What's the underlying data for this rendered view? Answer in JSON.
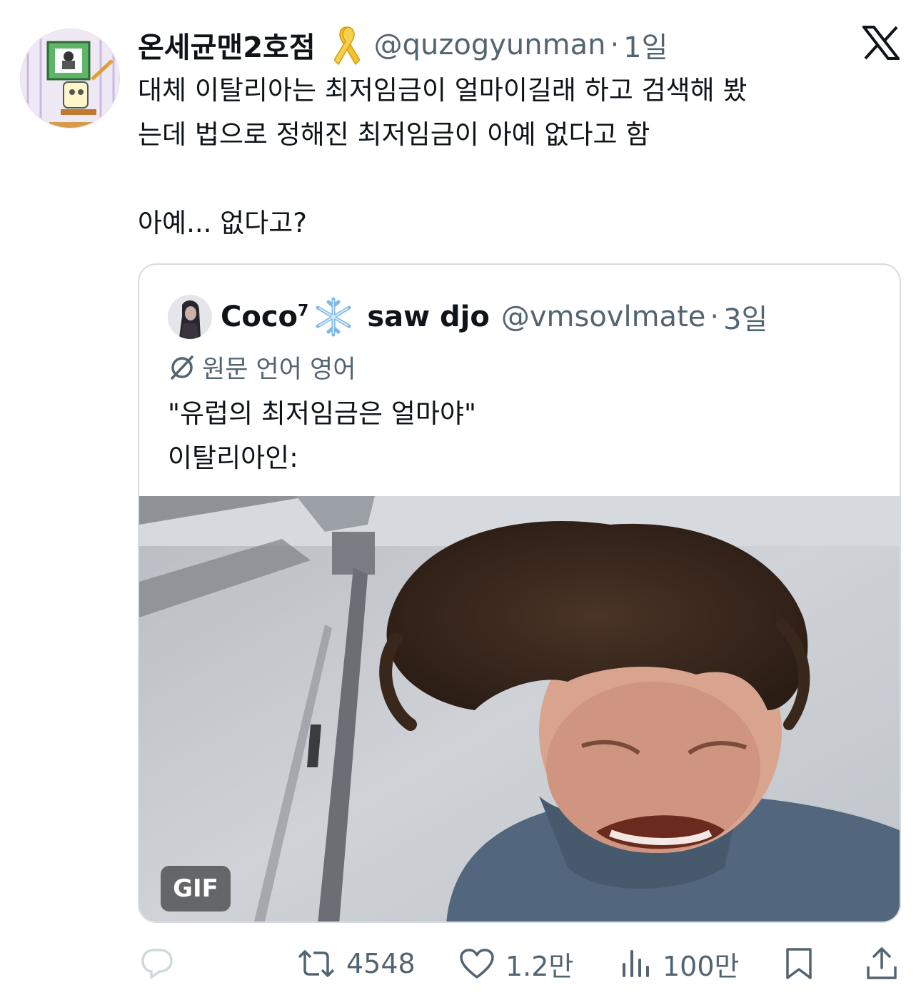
{
  "author": {
    "name": "온세균맨2호점",
    "handle": "@quzogyunman",
    "separator": "·",
    "time": "1일",
    "ribbon_icon": "yellow-ribbon-icon"
  },
  "tweet": {
    "line1": "대체 이탈리아는 최저임금이 얼마이길래 하고 검색해 봤",
    "line2": "는데 법으로 정해진 최저임금이 아예 없다고 함",
    "line3": "아예... 없다고?"
  },
  "quote": {
    "name": "Coco",
    "name_sup": "7",
    "name_emoji": "snowflake-icon",
    "name_suffix": "saw djo",
    "handle": "@vmsovlmate",
    "separator": "·",
    "time": "3일",
    "translate_label": "원문 언어 영어",
    "line1": "\"유럽의 최저임금은 얼마야\"",
    "line2": "이탈리아인:",
    "media_badge": "GIF"
  },
  "actions": {
    "reply_count": "",
    "retweet_count": "4548",
    "like_count": "1.2만",
    "views_count": "100만"
  },
  "colors": {
    "text": "#0f1419",
    "secondary": "#536471",
    "border": "#d7dce0"
  }
}
